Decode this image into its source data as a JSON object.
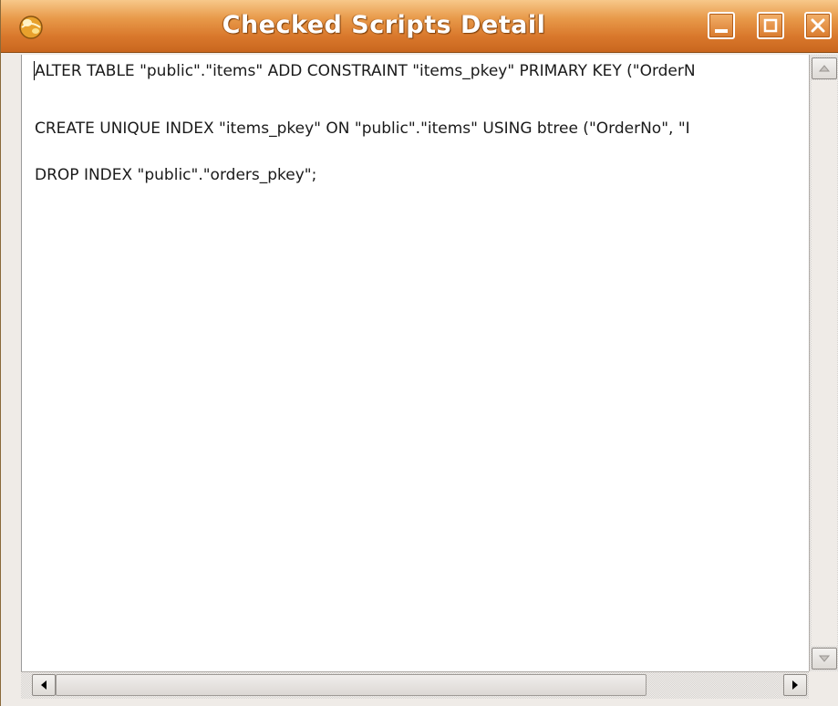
{
  "window": {
    "title": "Checked Scripts Detail",
    "accent_color": "#d9782c",
    "buttons": {
      "minimize_icon": "minimize-icon",
      "maximize_icon": "maximize-icon",
      "close_icon": "close-icon"
    }
  },
  "editor": {
    "lines": [
      "ALTER TABLE \"public\".\"items\" ADD CONSTRAINT \"items_pkey\" PRIMARY KEY (\"OrderN",
      "CREATE UNIQUE INDEX \"items_pkey\" ON \"public\".\"items\" USING btree (\"OrderNo\", \"I",
      "DROP INDEX \"public\".\"orders_pkey\";"
    ]
  }
}
